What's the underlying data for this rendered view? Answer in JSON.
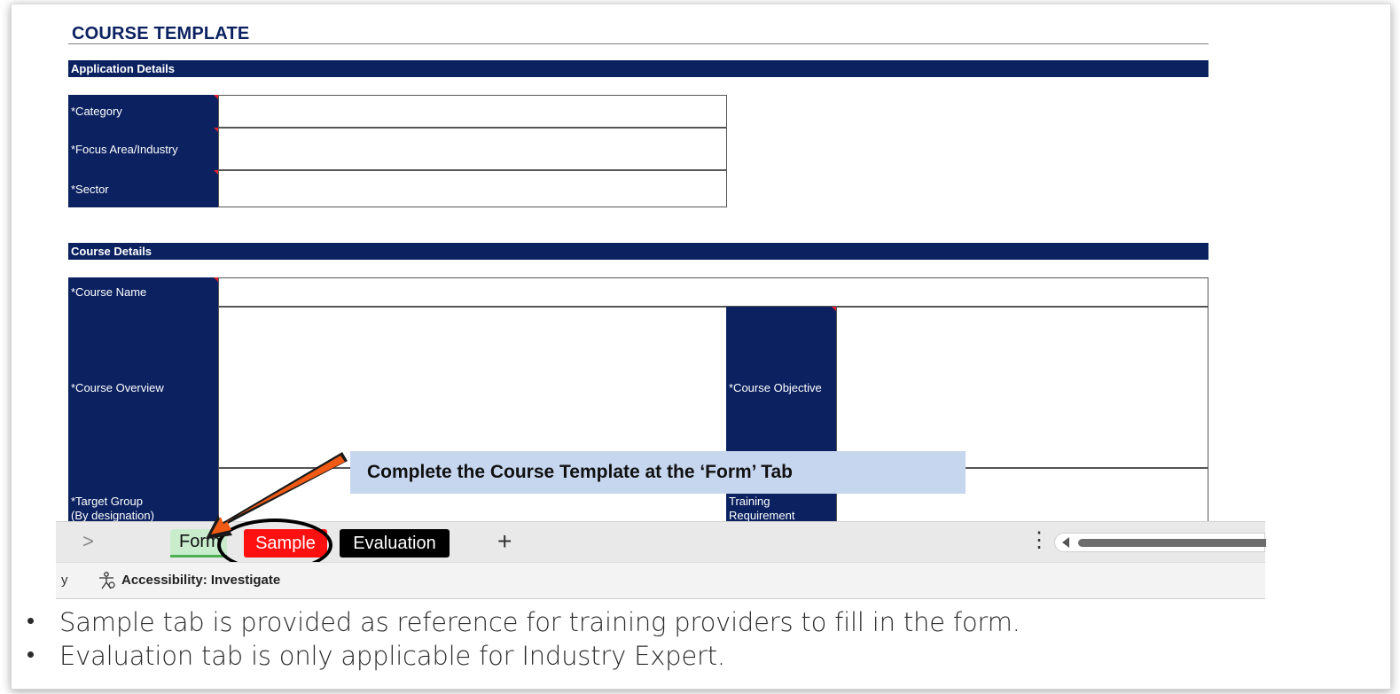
{
  "template": {
    "title": "COURSE TEMPLATE",
    "sections": {
      "application": {
        "header": "Application Details",
        "fields": [
          "*Category",
          "*Focus Area/Industry",
          "*Sector"
        ]
      },
      "course": {
        "header": "Course Details",
        "course_name": "*Course Name",
        "course_overview": "*Course Overview",
        "course_objective": "*Course Objective",
        "target_group_line1": "*Target Group",
        "target_group_line2": "(By designation)",
        "training_req_line1": "Training",
        "training_req_line2": "Requirement"
      }
    }
  },
  "callout": {
    "text": "Complete the Course Template at the ‘Form’ Tab"
  },
  "tabs": [
    {
      "label": "Form",
      "active": true
    },
    {
      "label": "Sample",
      "color": "#ff1010"
    },
    {
      "label": "Evaluation",
      "color": "#000000"
    }
  ],
  "tabbar": {
    "add_tab": "+",
    "nav_chevron": ">",
    "menu": "⋮"
  },
  "statusbar": {
    "leading_text": "y",
    "accessibility": "Accessibility: Investigate"
  },
  "notes": [
    "Sample tab is provided as reference for training providers to fill in the form.",
    "Evaluation tab is only applicable for Industry Expert."
  ],
  "colors": {
    "navy": "#0b2160",
    "arrow": "#f05a14",
    "callout_bg": "#c7d6ef"
  }
}
